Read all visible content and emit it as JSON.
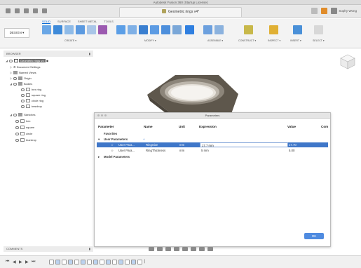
{
  "window": {
    "title": "Autodesk Fusion 360 (Startup License)"
  },
  "document_tab": {
    "label": "Geometric rings v4*"
  },
  "user": {
    "name": "Sophy Wong"
  },
  "ribbon": {
    "workspace": "DESIGN",
    "tabs": [
      "SOLID",
      "SURFACE",
      "SHEET METAL",
      "TOOLS"
    ],
    "groups": [
      "CREATE",
      "MODIFY",
      "ASSEMBLE",
      "CONSTRUCT",
      "INSPECT",
      "INSERT",
      "SELECT"
    ]
  },
  "browser": {
    "header": "BROWSER",
    "root": "Geometric rings v4",
    "items": [
      {
        "label": "Document Settings"
      },
      {
        "label": "Named Views"
      },
      {
        "label": "Origin"
      },
      {
        "label": "Bodies"
      },
      {
        "label": "hex ring"
      },
      {
        "label": "square ring"
      },
      {
        "label": "circle ring"
      },
      {
        "label": "teardrop"
      },
      {
        "label": "Sketches"
      },
      {
        "label": "hex"
      },
      {
        "label": "square"
      },
      {
        "label": "circle"
      },
      {
        "label": "teardrop"
      }
    ]
  },
  "dialog": {
    "title": "Parameters",
    "columns": [
      "Parameter",
      "Name",
      "Unit",
      "Expression",
      "Value",
      "Com"
    ],
    "sections": [
      "Favorites",
      "User Parameters",
      "Model Parameters"
    ],
    "rows": [
      {
        "parameter": "User Para...",
        "name": "RingSize",
        "unit": "mm",
        "expression": "17.7 mm",
        "value": "17.70"
      },
      {
        "parameter": "User Para...",
        "name": "RingThickness",
        "unit": "mm",
        "expression": "5 mm",
        "value": "5.00"
      }
    ],
    "ok_label": "OK"
  },
  "comments": {
    "label": "COMMENTS"
  },
  "colors": {
    "accent": "#0a6cd6",
    "selection": "#3f77c9",
    "nut": "#5e574c"
  }
}
